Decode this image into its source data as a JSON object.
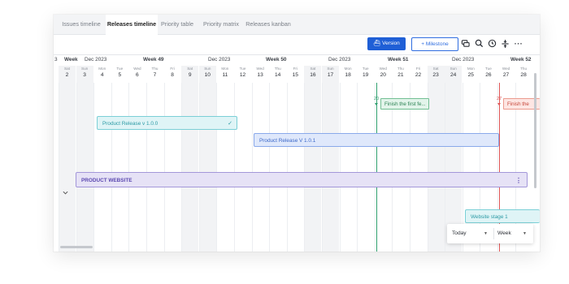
{
  "tabs": [
    {
      "label": "Issues timeline",
      "active": false
    },
    {
      "label": "Releases timeline",
      "active": true
    },
    {
      "label": "Priority table",
      "active": false
    },
    {
      "label": "Priority matrix",
      "active": false
    },
    {
      "label": "Releases kanban",
      "active": false
    }
  ],
  "toolbar": {
    "version_label": "Version",
    "milestone_label": "+ Milestone",
    "icons": [
      "comment-icon",
      "search-icon",
      "clock-icon",
      "expand-collapse-icon",
      "more-icon"
    ]
  },
  "calendar": {
    "week_headers": [
      {
        "month": "",
        "week": "Week"
      },
      {
        "month": "Dec 2023",
        "week": "Week 49"
      },
      {
        "month": "Dec 2023",
        "week": "Week 50"
      },
      {
        "month": "Dec 2023",
        "week": "Week 51"
      },
      {
        "month": "Dec 2023",
        "week": "Week 52"
      }
    ],
    "leading_num": "3",
    "days": [
      {
        "name": "Sat",
        "num": "2"
      },
      {
        "name": "Sun",
        "num": "3"
      },
      {
        "name": "Mon",
        "num": "4"
      },
      {
        "name": "Tue",
        "num": "5"
      },
      {
        "name": "Wed",
        "num": "6"
      },
      {
        "name": "Thu",
        "num": "7"
      },
      {
        "name": "Fri",
        "num": "8"
      },
      {
        "name": "Sat",
        "num": "9"
      },
      {
        "name": "Sun",
        "num": "10"
      },
      {
        "name": "Mon",
        "num": "11"
      },
      {
        "name": "Tue",
        "num": "12"
      },
      {
        "name": "Wed",
        "num": "13"
      },
      {
        "name": "Thu",
        "num": "14"
      },
      {
        "name": "Fri",
        "num": "15"
      },
      {
        "name": "Sat",
        "num": "16"
      },
      {
        "name": "Sun",
        "num": "17"
      },
      {
        "name": "Mon",
        "num": "18"
      },
      {
        "name": "Tue",
        "num": "19"
      },
      {
        "name": "Wed",
        "num": "20"
      },
      {
        "name": "Thu",
        "num": "21"
      },
      {
        "name": "Fri",
        "num": "22"
      },
      {
        "name": "Sat",
        "num": "23"
      },
      {
        "name": "Sun",
        "num": "24"
      },
      {
        "name": "Mon",
        "num": "25"
      },
      {
        "name": "Tue",
        "num": "26"
      },
      {
        "name": "Wed",
        "num": "27"
      },
      {
        "name": "Thu",
        "num": "28"
      }
    ]
  },
  "milestones": [
    {
      "num": "20",
      "label": "Finish the first fe...",
      "color": "#2e9f6e"
    },
    {
      "num": "27",
      "label": "Finish the",
      "color": "#e05555"
    }
  ],
  "releases": [
    {
      "label": "Product Release v 1.0.0",
      "style": "teal",
      "done": true
    },
    {
      "label": "Product Release V 1.0.1",
      "style": "blue",
      "done": false
    }
  ],
  "group": {
    "label": "PRODUCT WEBSITE",
    "collapsed": false
  },
  "stage": {
    "label": "Website stage 1"
  },
  "controls": {
    "today_label": "Today",
    "scale_label": "Week"
  },
  "colors": {
    "primary": "#1f5fd6",
    "teal": "#2c9aa5",
    "blue": "#3b68c9",
    "purple": "#5b48b0",
    "green": "#2e9f6e",
    "red": "#e05555"
  }
}
